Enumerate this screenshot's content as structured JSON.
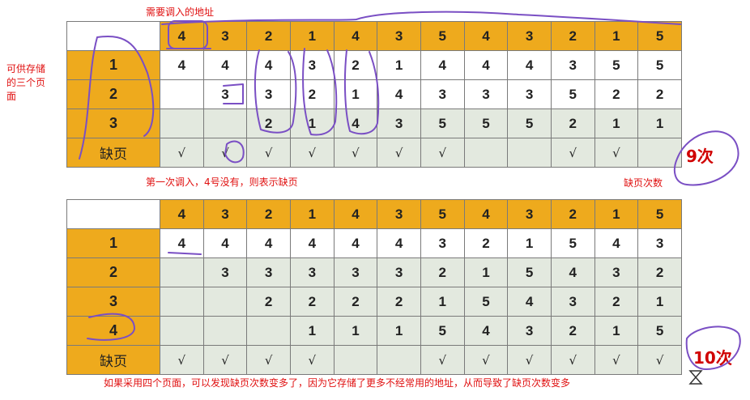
{
  "notes": {
    "top_label": "需要调入的地址",
    "left_label_line1": "可供存储",
    "left_label_line2": "的三个页",
    "left_label_line3": "面",
    "middle_label": "第一次调入，4号没有，则表示缺页",
    "fault_count_label": "缺页次数",
    "bottom_label": "如果采用四个页面，可以发现缺页次数变多了，因为它存储了更多不经常用的地址，从而导致了缺页次数变多",
    "count1": "9次",
    "count2": "10次"
  },
  "table1": {
    "header": [
      "4",
      "3",
      "2",
      "1",
      "4",
      "3",
      "5",
      "4",
      "3",
      "2",
      "1",
      "5"
    ],
    "rows": [
      {
        "label": "1",
        "cells": [
          "4",
          "4",
          "4",
          "3",
          "2",
          "1",
          "4",
          "4",
          "4",
          "3",
          "5",
          "5"
        ]
      },
      {
        "label": "2",
        "cells": [
          "",
          "3",
          "3",
          "2",
          "1",
          "4",
          "3",
          "3",
          "3",
          "5",
          "2",
          "2"
        ]
      },
      {
        "label": "3",
        "cells": [
          "",
          "",
          "2",
          "1",
          "4",
          "3",
          "5",
          "5",
          "5",
          "2",
          "1",
          "1"
        ]
      }
    ],
    "fault_label": "缺页",
    "faults": [
      "√",
      "√",
      "√",
      "√",
      "√",
      "√",
      "√",
      "",
      "",
      "√",
      "√",
      ""
    ]
  },
  "table2": {
    "header": [
      "4",
      "3",
      "2",
      "1",
      "4",
      "3",
      "5",
      "4",
      "3",
      "2",
      "1",
      "5"
    ],
    "rows": [
      {
        "label": "1",
        "cells": [
          "4",
          "4",
          "4",
          "4",
          "4",
          "4",
          "3",
          "2",
          "1",
          "5",
          "4",
          "3"
        ]
      },
      {
        "label": "2",
        "cells": [
          "",
          "3",
          "3",
          "3",
          "3",
          "3",
          "2",
          "1",
          "5",
          "4",
          "3",
          "2"
        ]
      },
      {
        "label": "3",
        "cells": [
          "",
          "",
          "2",
          "2",
          "2",
          "2",
          "1",
          "5",
          "4",
          "3",
          "2",
          "1"
        ]
      },
      {
        "label": "4",
        "cells": [
          "",
          "",
          "",
          "1",
          "1",
          "1",
          "5",
          "4",
          "3",
          "2",
          "1",
          "5"
        ]
      }
    ],
    "fault_label": "缺页",
    "faults": [
      "√",
      "√",
      "√",
      "√",
      "",
      "",
      "√",
      "√",
      "√",
      "√",
      "√",
      "√"
    ]
  },
  "colors": {
    "header_fill": "#eeaa1d",
    "even_row_fill": "#e3e9df",
    "annotation_red": "#e01010",
    "ink_purple": "#7a4fc4"
  },
  "icons": {
    "cursor": "hourglass-icon"
  }
}
